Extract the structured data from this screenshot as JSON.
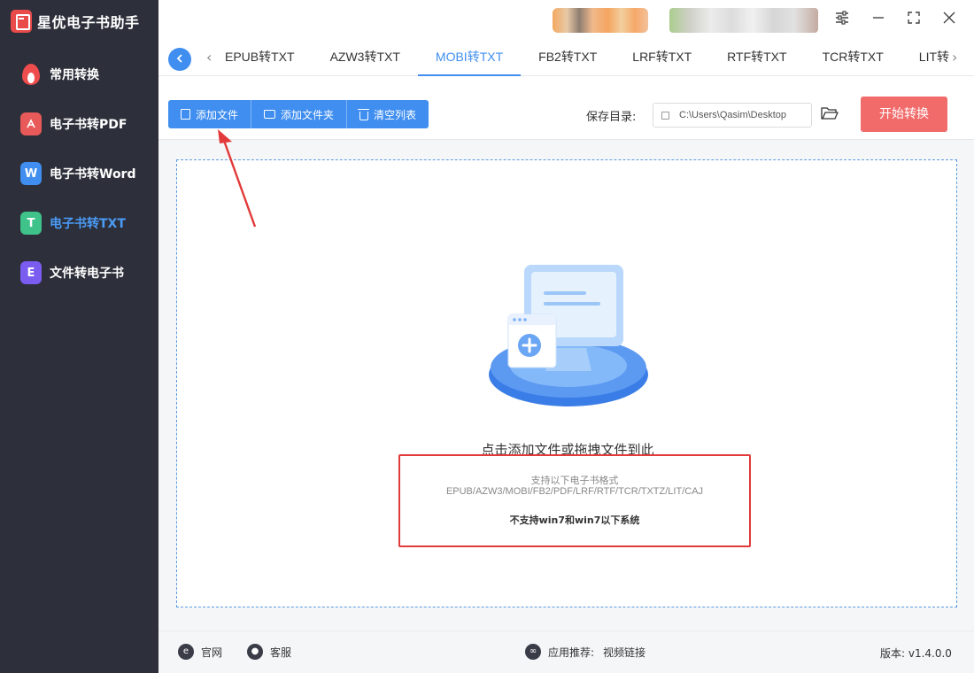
{
  "app": {
    "title": "星优电子书助手"
  },
  "sidebar": {
    "items": [
      {
        "label": "常用转换",
        "icon": "fire-icon"
      },
      {
        "label": "电子书转PDF",
        "icon": "pdf-icon"
      },
      {
        "label": "电子书转Word",
        "icon": "word-icon",
        "icon_glyph": "W"
      },
      {
        "label": "电子书转TXT",
        "icon": "txt-icon",
        "icon_glyph": "T",
        "active": true
      },
      {
        "label": "文件转电子书",
        "icon": "ebook-icon",
        "icon_glyph": "E"
      }
    ]
  },
  "tabs": {
    "items": [
      "EPUB转TXT",
      "AZW3转TXT",
      "MOBI转TXT",
      "FB2转TXT",
      "LRF转TXT",
      "RTF转TXT",
      "TCR转TXT",
      "LIT转TXT"
    ],
    "active": "MOBI转TXT"
  },
  "toolbar": {
    "add_file": "添加文件",
    "add_folder": "添加文件夹",
    "clear_list": "清空列表",
    "save_dir_label": "保存目录:",
    "save_dir_value": "C:\\Users\\Qasim\\Desktop",
    "start_label": "开始转换"
  },
  "dropzone": {
    "title": "点击添加文件或拖拽文件到此",
    "formats_title": "支持以下电子书格式",
    "formats_list": "EPUB/AZW3/MOBI/FB2/PDF/LRF/RTF/TCR/TXTZ/LIT/CAJ",
    "warning": "不支持win7和win7以下系统"
  },
  "footer": {
    "website": "官网",
    "support": "客服",
    "recommend_label": "应用推荐:",
    "recommend_link": "视频链接",
    "version": "版本: v1.4.0.0"
  },
  "colors": {
    "sidebar_bg": "#2d2f3a",
    "accent": "#3f8ef0",
    "start_button": "#f26b6b",
    "highlight": "#e23a3a"
  }
}
